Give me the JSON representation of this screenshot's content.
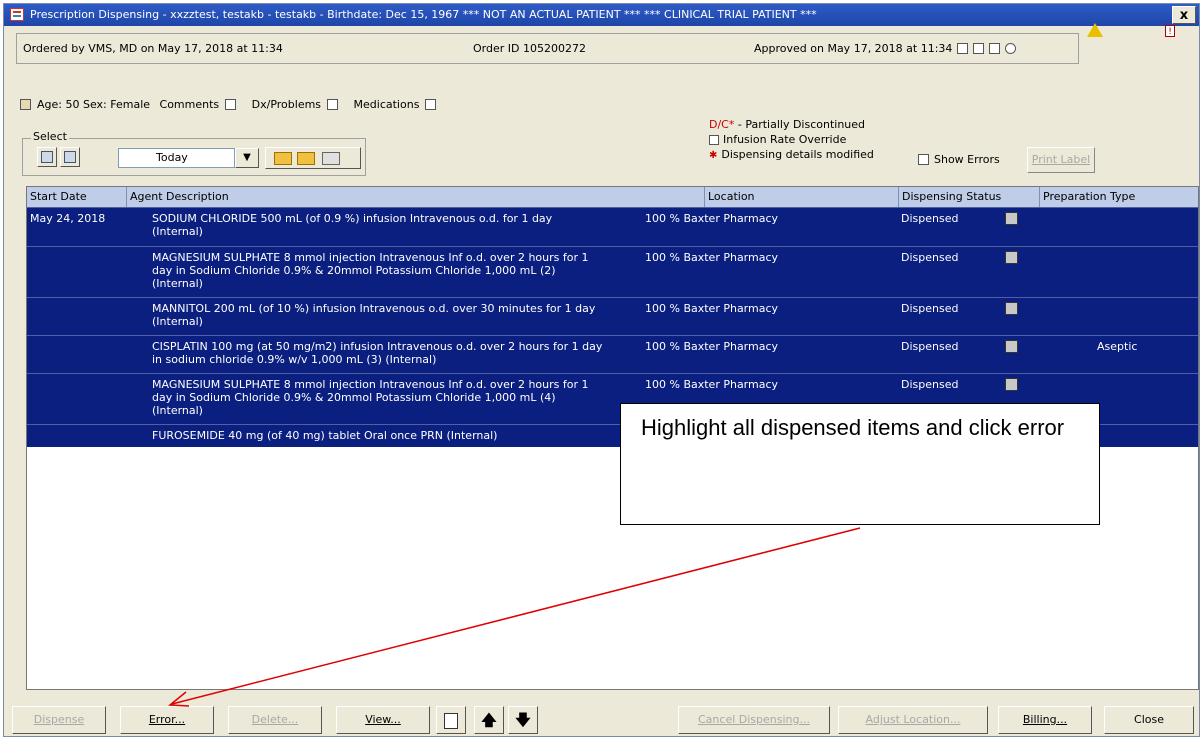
{
  "window": {
    "title": "Prescription Dispensing - xxzztest, testakb - testakb - Birthdate: Dec 15, 1967 *** NOT AN ACTUAL PATIENT *** *** CLINICAL TRIAL PATIENT ***",
    "close_label": "x"
  },
  "order": {
    "ordered_by": "Ordered by VMS, MD on May 17, 2018 at 11:34",
    "order_id": "Order ID 105200272",
    "approved": "Approved on May 17, 2018 at 11:34"
  },
  "patient": {
    "age_sex": "Age: 50  Sex: Female",
    "comments": "Comments",
    "dx_problems": "Dx/Problems",
    "medications": "Medications"
  },
  "select": {
    "legend": "Select",
    "period": "Today"
  },
  "legend": {
    "dc_code": "D/C*",
    "dc_text": " - Partially Discontinued",
    "infusion": "Infusion Rate Override",
    "modified": "Dispensing details modified"
  },
  "show_errors_label": "Show Errors",
  "print_label": "Print Label",
  "table": {
    "headers": [
      "Start Date",
      "Agent Description",
      "Location",
      "Dispensing Status",
      "Preparation Type"
    ],
    "rows": [
      {
        "start_date": "May 24, 2018",
        "description": "SODIUM CHLORIDE 500 mL (of 0.9 %) infusion Intravenous o.d. for 1 day (Internal)",
        "location": "100 % Baxter Pharmacy",
        "status": "Dispensed",
        "prep": ""
      },
      {
        "start_date": "",
        "description": "MAGNESIUM SULPHATE 8 mmol injection Intravenous Inf o.d. over 2 hours for 1 day in Sodium Chloride 0.9% & 20mmol Potassium Chloride 1,000 mL (2) (Internal)",
        "location": "100 % Baxter Pharmacy",
        "status": "Dispensed",
        "prep": ""
      },
      {
        "start_date": "",
        "description": "MANNITOL 200 mL (of 10 %) infusion Intravenous o.d. over 30 minutes for 1 day   (Internal)",
        "location": "100 % Baxter Pharmacy",
        "status": "Dispensed",
        "prep": ""
      },
      {
        "start_date": "",
        "description": "CISPLATIN 100 mg (at 50 mg/m2) infusion Intravenous o.d. over 2 hours for 1 day in sodium chloride 0.9% w/v 1,000 mL (3)   (Internal)",
        "location": "100 % Baxter Pharmacy",
        "status": "Dispensed",
        "prep": "Aseptic"
      },
      {
        "start_date": "",
        "description": "MAGNESIUM SULPHATE 8 mmol injection Intravenous Inf o.d. over 2 hours for 1 day in Sodium Chloride 0.9% & 20mmol Potassium Chloride 1,000 mL (4) (Internal)",
        "location": "100 % Baxter Pharmacy",
        "status": "Dispensed",
        "prep": ""
      },
      {
        "start_date": "",
        "description": "FUROSEMIDE 40 mg (of 40 mg) tablet Oral once PRN   (Internal)",
        "location": "",
        "status": "",
        "prep": ""
      }
    ]
  },
  "callout": {
    "text": "Highlight all dispensed items and click error",
    "arrow_color": "#e00000"
  },
  "buttons": {
    "dispense": "Dispense",
    "error": "Error...",
    "delete": "Delete...",
    "view": "View...",
    "cancel_dispensing": "Cancel Dispensing...",
    "adjust_location": "Adjust Location...",
    "billing": "Billing...",
    "close": "Close"
  },
  "colors": {
    "selection": "#0a1f7f",
    "title_bar": "#2452b8",
    "dc_red": "#cc0000"
  }
}
